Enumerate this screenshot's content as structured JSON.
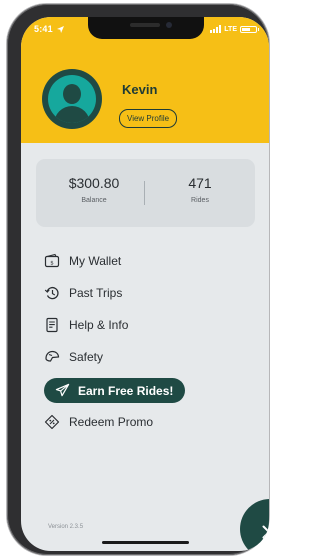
{
  "status_bar": {
    "time": "5:41",
    "network": "LTE",
    "battery_level": 0.6
  },
  "profile": {
    "name": "Kevin",
    "view_profile_label": "View Profile",
    "avatar_icon": "user-avatar-icon"
  },
  "stats": {
    "balance": {
      "value": "$300.80",
      "label": "Balance"
    },
    "rides": {
      "value": "471",
      "label": "Rides"
    }
  },
  "menu": {
    "items": [
      {
        "id": "wallet",
        "label": "My Wallet",
        "icon": "wallet-icon"
      },
      {
        "id": "trips",
        "label": "Past Trips",
        "icon": "history-icon"
      },
      {
        "id": "help",
        "label": "Help & Info",
        "icon": "document-icon"
      },
      {
        "id": "safety",
        "label": "Safety",
        "icon": "helmet-icon"
      },
      {
        "id": "earn",
        "label": "Earn Free Rides!",
        "icon": "paper-plane-icon"
      },
      {
        "id": "redeem",
        "label": "Redeem Promo",
        "icon": "promo-tag-icon"
      }
    ]
  },
  "footer": {
    "version": "Version 2.3.5"
  },
  "colors": {
    "header_yellow": "#f6bf16",
    "dark_teal": "#1f4a44",
    "avatar_teal": "#16a89d",
    "screen_bg": "#e6e9eb",
    "card_bg": "#d9dde0"
  }
}
